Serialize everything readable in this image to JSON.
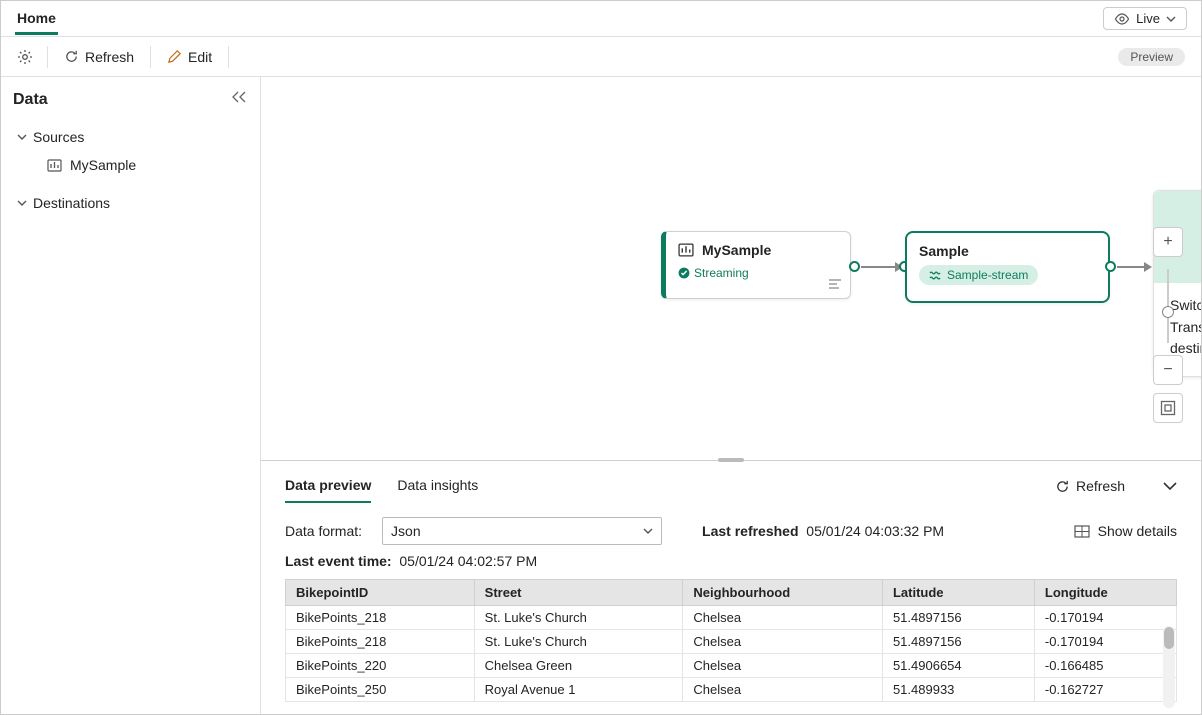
{
  "header": {
    "home_tab": "Home",
    "live_label": "Live"
  },
  "toolbar": {
    "refresh_label": "Refresh",
    "edit_label": "Edit",
    "preview_pill": "Preview"
  },
  "sidebar": {
    "title": "Data",
    "sources_label": "Sources",
    "destinations_label": "Destinations",
    "source_item": "MySample"
  },
  "canvas": {
    "source_node": {
      "title": "MySample",
      "status": "Streaming"
    },
    "stream_node": {
      "title": "Sample",
      "pill": "Sample-stream"
    },
    "dest_node": {
      "slash": "/",
      "text": "Switch to edit mode to Transform event or add destination"
    }
  },
  "preview": {
    "tab_preview": "Data preview",
    "tab_insights": "Data insights",
    "refresh_label": "Refresh",
    "data_format_label": "Data format:",
    "data_format_value": "Json",
    "last_refreshed_label": "Last refreshed",
    "last_refreshed_value": "05/01/24 04:03:32 PM",
    "show_details_label": "Show details",
    "last_event_label": "Last event time:",
    "last_event_value": "05/01/24 04:02:57 PM",
    "columns": [
      "BikepointID",
      "Street",
      "Neighbourhood",
      "Latitude",
      "Longitude"
    ],
    "rows": [
      {
        "id": "BikePoints_218",
        "street": "St. Luke's Church",
        "hood": "Chelsea",
        "lat": "51.4897156",
        "lon": "-0.170194"
      },
      {
        "id": "BikePoints_218",
        "street": "St. Luke's Church",
        "hood": "Chelsea",
        "lat": "51.4897156",
        "lon": "-0.170194"
      },
      {
        "id": "BikePoints_220",
        "street": "Chelsea Green",
        "hood": "Chelsea",
        "lat": "51.4906654",
        "lon": "-0.166485"
      },
      {
        "id": "BikePoints_250",
        "street": "Royal Avenue 1",
        "hood": "Chelsea",
        "lat": "51.489933",
        "lon": "-0.162727"
      }
    ]
  }
}
